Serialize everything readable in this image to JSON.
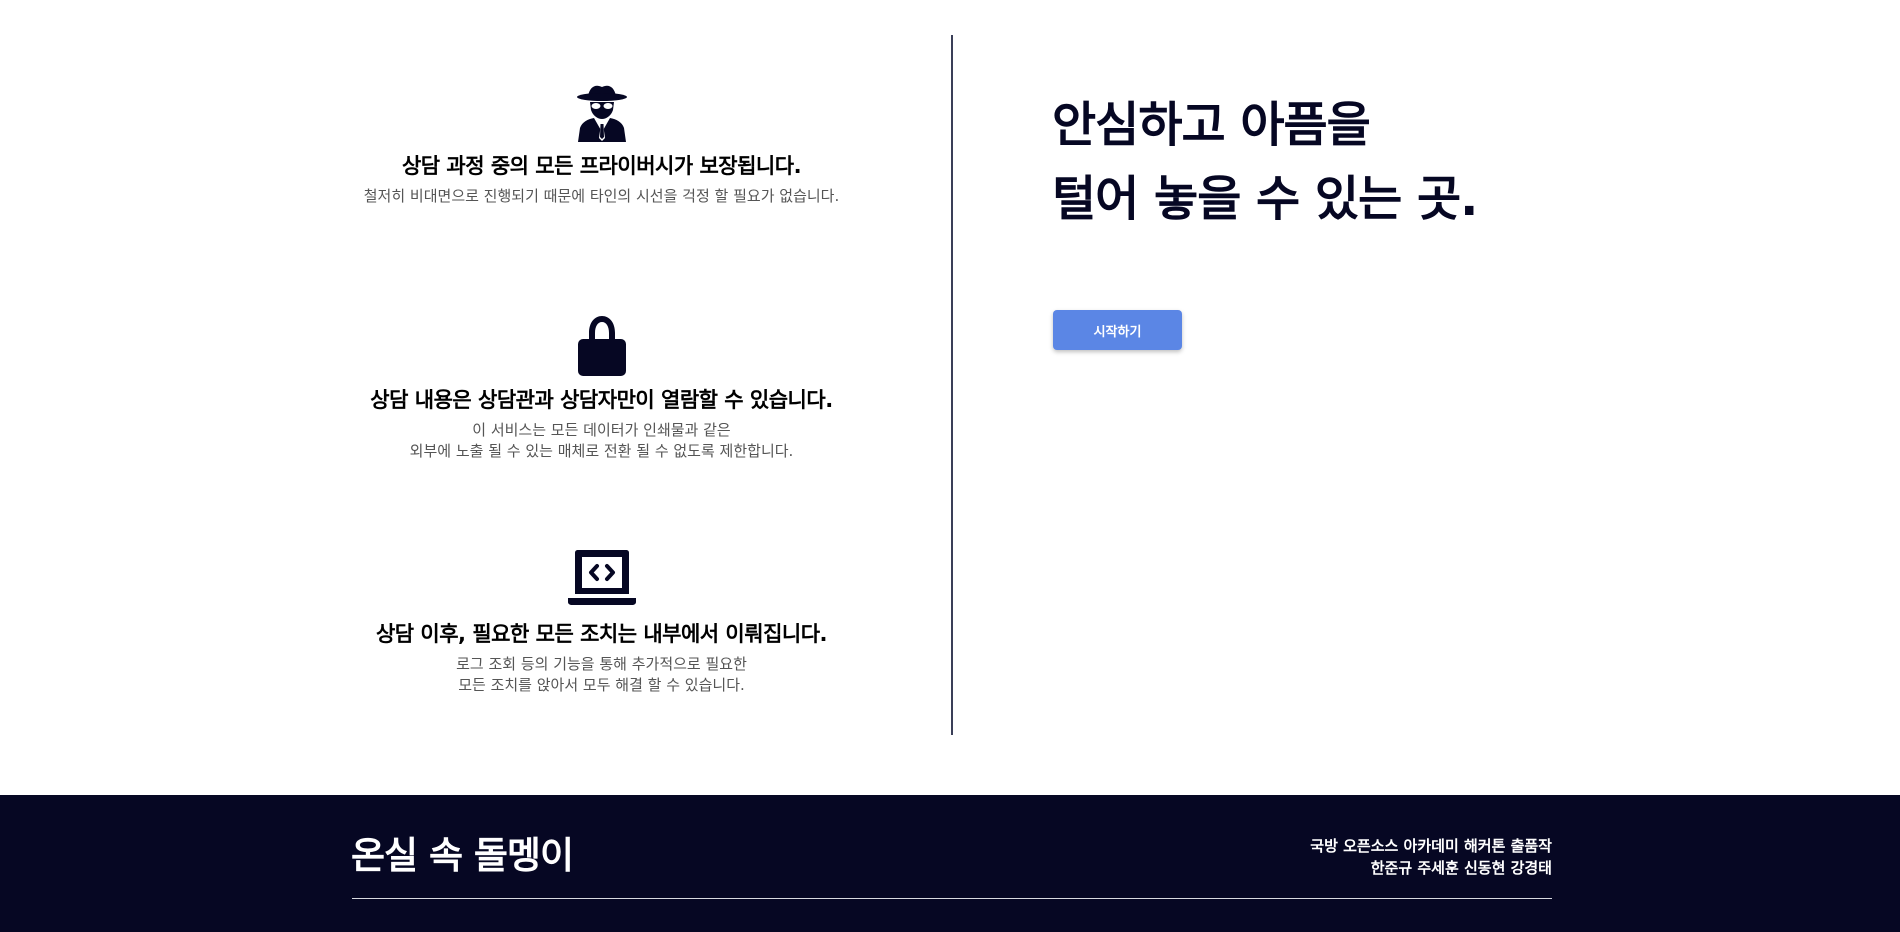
{
  "features": [
    {
      "icon": "spy-icon",
      "title": "상담 과정 중의 모든 프라이버시가 보장됩니다.",
      "desc_lines": [
        "철저히 비대면으로 진행되기 때문에 타인의 시선을 걱정 할 필요가 없습니다."
      ]
    },
    {
      "icon": "lock-icon",
      "title": "상담 내용은 상담관과 상담자만이 열람할 수 있습니다.",
      "desc_lines": [
        "이 서비스는 모든 데이터가 인쇄물과 같은",
        "외부에 노출 될 수 있는 매체로 전환 될 수 없도록 제한합니다."
      ]
    },
    {
      "icon": "laptop-code-icon",
      "title": "상담 이후, 필요한 모든 조치는 내부에서 이뤄집니다.",
      "desc_lines": [
        "로그 조회 등의 기능을 통해 추가적으로 필요한",
        "모든 조치를 앉아서 모두 해결 할 수 있습니다."
      ]
    }
  ],
  "hero": {
    "headline_lines": [
      "안심하고 아픔을",
      "털어 놓을 수 있는 곳."
    ],
    "start_label": "시작하기"
  },
  "footer": {
    "logo": "온실 속 돌멩이",
    "credits_lines": [
      "국방 오픈소스 아카데미 해커톤 출품작",
      "한준규 주세훈 신동현 강경태"
    ]
  },
  "colors": {
    "navy": "#060723",
    "button": "#5b86e5",
    "divider": "#3a3f58"
  }
}
